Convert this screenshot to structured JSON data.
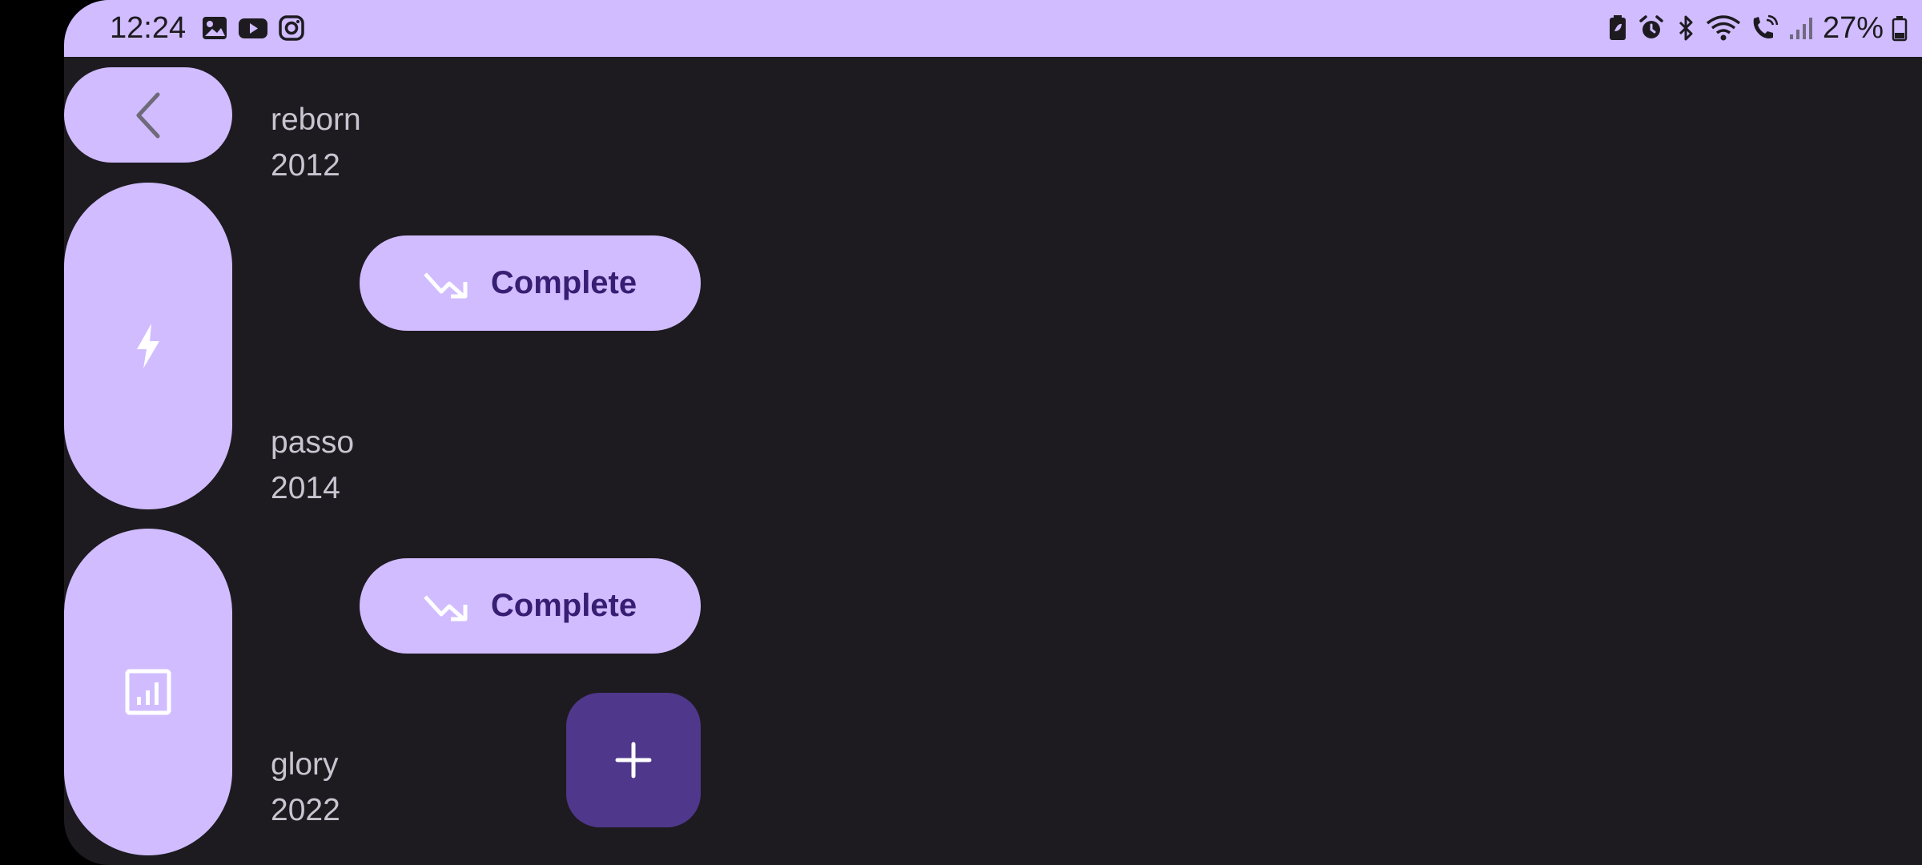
{
  "status_bar": {
    "time": "12:24",
    "left_icons": [
      "gallery-icon",
      "youtube-icon",
      "instagram-icon"
    ],
    "right_icons": [
      "battery-saver-icon",
      "alarm-icon",
      "bluetooth-icon",
      "wifi-icon",
      "wifi-calling-icon",
      "signal-icon"
    ],
    "battery": "27%"
  },
  "nav": {
    "back_icon": "back-arrow-icon",
    "items": [
      {
        "icon": "lightning-icon"
      },
      {
        "icon": "chart-icon"
      }
    ]
  },
  "entries": [
    {
      "name": "reborn",
      "year": "2012",
      "action": "Complete",
      "action_icon": "trending-down-icon"
    },
    {
      "name": "passo",
      "year": "2014",
      "action": "Complete",
      "action_icon": "trending-down-icon"
    },
    {
      "name": "glory",
      "year": "2022"
    }
  ],
  "fab": {
    "icon": "plus-icon"
  },
  "colors": {
    "background": "#1d1b20",
    "primary_container": "#d0bcff",
    "on_primary_container": "#381e72",
    "fab": "#4f378b",
    "text": "#cac4d0"
  }
}
